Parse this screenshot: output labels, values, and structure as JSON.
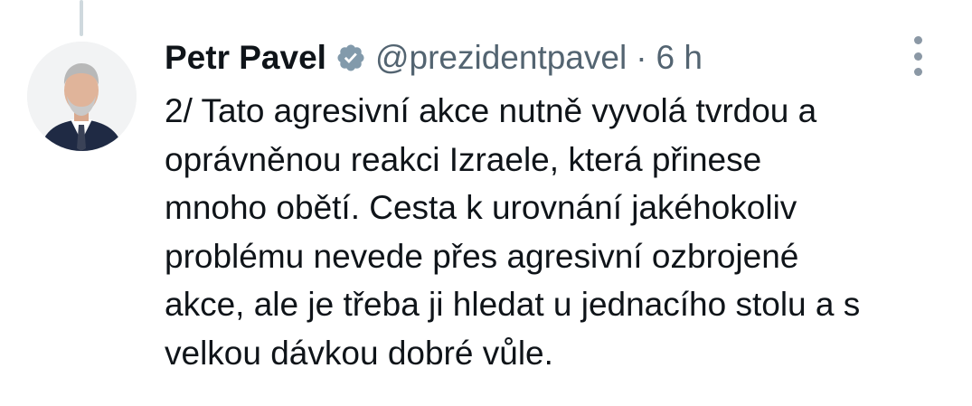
{
  "author": {
    "display_name": "Petr Pavel",
    "handle": "@prezidentpavel",
    "separator": "·",
    "time": "6 h",
    "verified": true
  },
  "colors": {
    "text": "#0f1419",
    "secondary": "#536471",
    "verified_badge": "#829aab",
    "thread_line": "#cfd9de"
  },
  "icons": {
    "verified": "verified-badge-icon",
    "more": "more-vertical-icon"
  },
  "tweet": {
    "lines": [
      "2/ Tato agresivní akce nutně vyvolá tvrdou a",
      "oprávněnou reakci Izraele, která přinese",
      "mnoho obětí. Cesta k urovnání jakéhokoliv",
      "problému nevede přes agresivní ozbrojené",
      "akce, ale je třeba ji hledat u jednacího stolu a s",
      "velkou dávkou dobré vůle."
    ]
  }
}
